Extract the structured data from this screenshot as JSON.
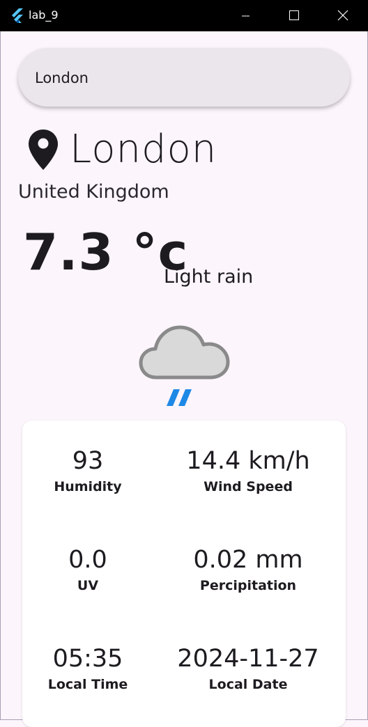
{
  "window": {
    "title": "lab_9"
  },
  "search": {
    "value": "London"
  },
  "location": {
    "city": "London",
    "country": "United Kingdom"
  },
  "current": {
    "temperature": "7.3 °c",
    "condition": "Light rain",
    "icon": "rain-cloud-icon"
  },
  "stats": {
    "humidity": {
      "value": "93",
      "label": "Humidity"
    },
    "wind": {
      "value": "14.4 km/h",
      "label": "Wind Speed"
    },
    "uv": {
      "value": "0.0",
      "label": "UV"
    },
    "precip": {
      "value": "0.02 mm",
      "label": "Percipitation"
    },
    "time": {
      "value": "05:35",
      "label": "Local Time"
    },
    "date": {
      "value": "2024-11-27",
      "label": "Local Date"
    }
  },
  "colors": {
    "titlebar": "#000000",
    "background": "#fcf5fc",
    "search": "#ebe5ec",
    "rain": "#1e88e5"
  }
}
